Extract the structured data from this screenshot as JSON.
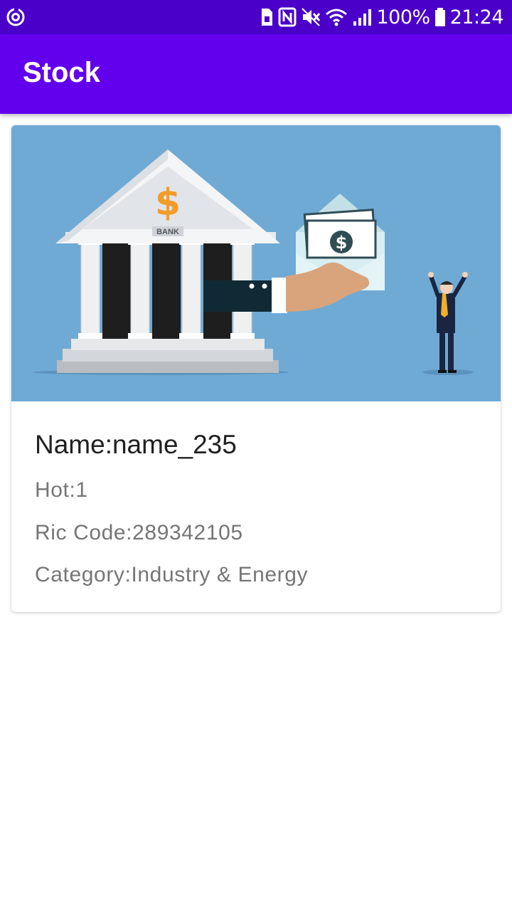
{
  "status_bar": {
    "battery": "100%",
    "time": "21:24",
    "icons": [
      "sync-icon",
      "sim-icon",
      "nfc-icon",
      "mute-icon",
      "wifi-icon",
      "signal-icon",
      "battery-icon"
    ]
  },
  "app_bar": {
    "title": "Stock"
  },
  "stock": {
    "image_label": "BANK",
    "name": "Name:name_235",
    "hot": "Hot:1",
    "ric_code": "Ric Code:289342105",
    "category": "Category:Industry & Energy"
  },
  "colors": {
    "status_bar": "#4a00c9",
    "app_bar": "#6200ee",
    "image_bg": "#6faad5",
    "primary_text": "#202020",
    "secondary_text": "#757575"
  }
}
